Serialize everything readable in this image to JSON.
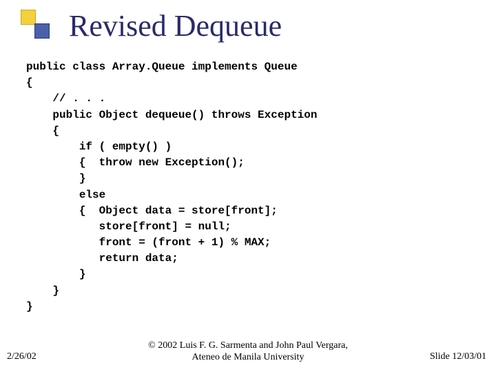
{
  "title": "Revised Dequeue",
  "code": "public class Array.Queue implements Queue\n{\n    // . . .\n    public Object dequeue() throws Exception\n    {\n        if ( empty() )\n        {  throw new Exception();\n        }\n        else\n        {  Object data = store[front];\n           store[front] = null;\n           front = (front + 1) % MAX;\n           return data;\n        }\n    }\n}",
  "footer": {
    "date": "2/26/02",
    "copyright_line1": "© 2002 Luis F. G. Sarmenta and John Paul Vergara,",
    "copyright_line2": "Ateneo de Manila University",
    "slide": "Slide 12/03/01"
  }
}
